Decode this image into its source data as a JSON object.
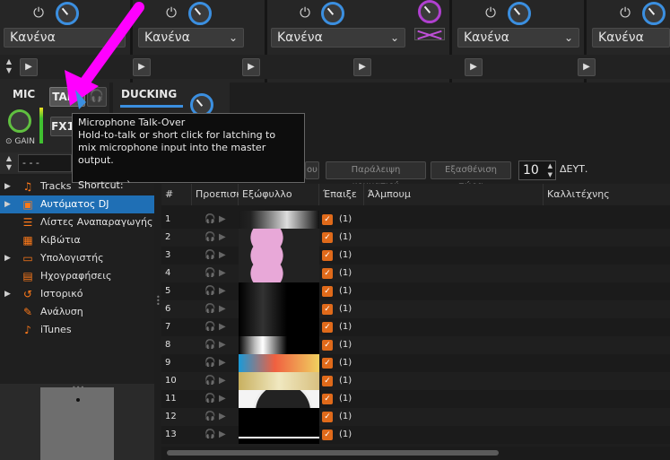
{
  "decks": {
    "selects": [
      "Κανένα",
      "Κανένα",
      "Κανένα",
      "Κανένα",
      "Κανένα"
    ]
  },
  "mic": {
    "label": "MIC",
    "talk_label": "TALK",
    "gain_label": "GAIN",
    "fx_label": "FX1"
  },
  "ducking": {
    "label": "DUCKING"
  },
  "tooltip": {
    "title": "Microphone Talk-Over",
    "line1": "Hold-to-talk or short click for latching to",
    "line2": "mix microphone input into the master output.",
    "shortcut": "Shortcut: `"
  },
  "search": {
    "value": "- - -"
  },
  "toolbar": {
    "partial_label": "ου",
    "skip_label": "Παράλειψη κομματιού",
    "fade_label": "Εξασθένιση τώρα",
    "seconds_value": "10",
    "seconds_unit": "ΔΕΥΤ."
  },
  "sidebar": {
    "items": [
      {
        "label": "Tracks",
        "icon": "music-note-icon",
        "expandable": true
      },
      {
        "label": "Αυτόματος DJ",
        "icon": "auto-dj-icon",
        "expandable": true,
        "selected": true
      },
      {
        "label": "Λίστες Αναπαραγωγής",
        "icon": "playlist-icon",
        "expandable": false
      },
      {
        "label": "Κιβώτια",
        "icon": "crate-icon",
        "expandable": false
      },
      {
        "label": "Υπολογιστής",
        "icon": "computer-icon",
        "expandable": true
      },
      {
        "label": "Ηχογραφήσεις",
        "icon": "recording-icon",
        "expandable": false
      },
      {
        "label": "Ιστορικό",
        "icon": "history-icon",
        "expandable": true
      },
      {
        "label": "Ανάλυση",
        "icon": "analyze-icon",
        "expandable": false
      },
      {
        "label": "iTunes",
        "icon": "itunes-icon",
        "expandable": false
      }
    ]
  },
  "table": {
    "headers": {
      "num": "#",
      "preview": "Προεπισκ",
      "cover": "Εξώφυλλο",
      "played": "Έπαιξε",
      "album": "Άλμπουμ",
      "artist": "Καλλιτέχνης"
    },
    "rows": [
      {
        "num": "1",
        "count": "(1)"
      },
      {
        "num": "2",
        "count": "(1)"
      },
      {
        "num": "3",
        "count": "(1)"
      },
      {
        "num": "4",
        "count": "(1)"
      },
      {
        "num": "5",
        "count": "(1)"
      },
      {
        "num": "6",
        "count": "(1)"
      },
      {
        "num": "7",
        "count": "(1)"
      },
      {
        "num": "8",
        "count": "(1)"
      },
      {
        "num": "9",
        "count": "(1)"
      },
      {
        "num": "10",
        "count": "(1)"
      },
      {
        "num": "11",
        "count": "(1)"
      },
      {
        "num": "12",
        "count": "(1)"
      },
      {
        "num": "13",
        "count": "(1)"
      }
    ]
  },
  "colors": {
    "accent": "#1f6fb5",
    "orange": "#ff7a1a",
    "arrow": "#ff00ff"
  }
}
